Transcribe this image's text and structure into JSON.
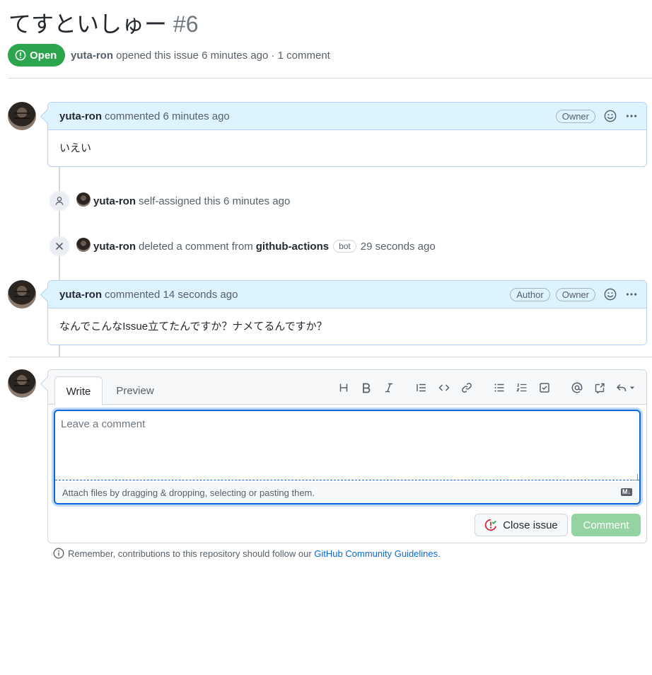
{
  "issue": {
    "title": "てすといしゅー",
    "number": "#6",
    "state": "Open",
    "author": "yuta-ron",
    "opened_text": "opened this issue 6 minutes ago · 1 comment"
  },
  "comments": [
    {
      "author": "yuta-ron",
      "action": "commented 6 minutes ago",
      "labels": [
        "Owner"
      ],
      "body": "いえい"
    },
    {
      "author": "yuta-ron",
      "action": "commented 14 seconds ago",
      "labels": [
        "Author",
        "Owner"
      ],
      "body": "なんでこんなIssue立てたんですか？ナメてるんですか？"
    }
  ],
  "events": [
    {
      "icon": "person-icon",
      "actor": "yuta-ron",
      "text": "self-assigned this 6 minutes ago"
    },
    {
      "icon": "x-icon",
      "actor": "yuta-ron",
      "text": "deleted a comment from",
      "target": "github-actions",
      "tag": "bot",
      "time": "29 seconds ago"
    }
  ],
  "editor": {
    "tabs": [
      "Write",
      "Preview"
    ],
    "placeholder": "Leave a comment",
    "attach_text": "Attach files by dragging & dropping, selecting or pasting them.",
    "md_badge": "M↓",
    "close_label": "Close issue",
    "comment_label": "Comment"
  },
  "footer": {
    "text": "Remember, contributions to this repository should follow our",
    "link": "GitHub Community Guidelines",
    "period": "."
  },
  "colors": {
    "open": "#2da44e",
    "link": "#0969da",
    "comment_disabled": "#94d3a2",
    "close_icon": "#cf222e"
  }
}
